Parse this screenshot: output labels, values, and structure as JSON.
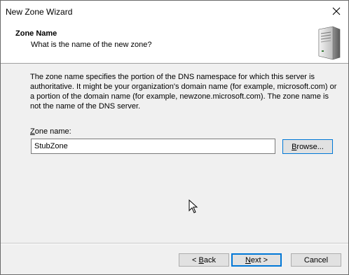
{
  "window": {
    "title": "New Zone Wizard"
  },
  "header": {
    "title": "Zone Name",
    "subtitle": "What is the name of the new zone?",
    "icon": "server-icon"
  },
  "body": {
    "description": "The zone name specifies the portion of the DNS namespace for which this server is authoritative. It might be your organization's domain name (for example,  microsoft.com) or a portion of the domain name (for example, newzone.microsoft.com). The zone name is not the name of the DNS server."
  },
  "zone_field": {
    "label_prefix": "",
    "label_key": "Z",
    "label_rest": "one name:",
    "value": "StubZone"
  },
  "buttons": {
    "browse": {
      "prefix": "",
      "key": "B",
      "rest": "rowse..."
    },
    "back": {
      "prefix": "< ",
      "key": "B",
      "rest": "ack"
    },
    "next": {
      "prefix": "",
      "key": "N",
      "rest": "ext >"
    },
    "cancel": {
      "label": "Cancel"
    }
  },
  "colors": {
    "accent": "#0078d7",
    "header_bg": "#ffffff",
    "body_bg": "#f0f0f0"
  }
}
